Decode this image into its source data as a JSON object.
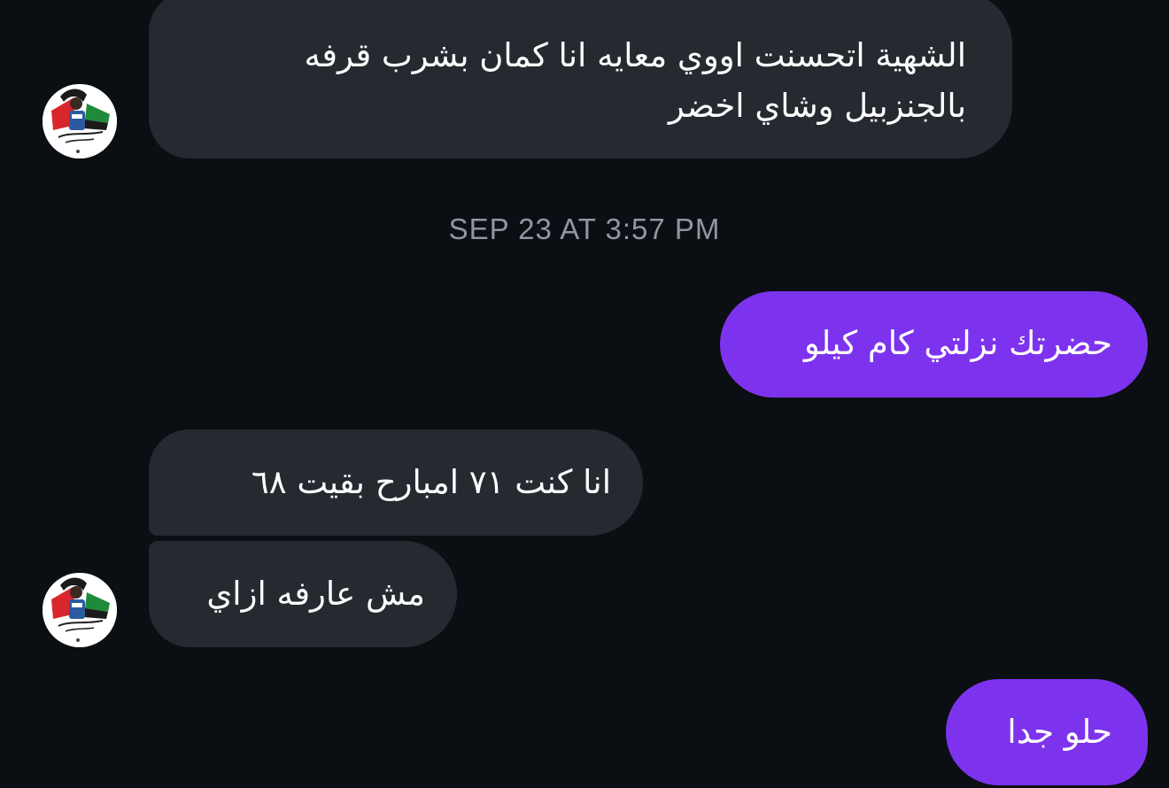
{
  "conversation": {
    "messages": [
      {
        "direction": "incoming",
        "text": "الشهية اتحسنت اووي معايه انا كمان بشرب قرفه بالجنزبيل وشاي اخضر"
      },
      {
        "direction": "outgoing",
        "text": "حضرتك نزلتي كام كيلو"
      },
      {
        "direction": "incoming",
        "text": "انا كنت ٧١ امبارح بقيت ٦٨"
      },
      {
        "direction": "incoming",
        "text": "مش عارفه ازاي"
      },
      {
        "direction": "outgoing",
        "text": "حلو جدا"
      }
    ],
    "timestamp": "SEP 23 AT 3:57 PM"
  },
  "colors": {
    "background": "#0b0e12",
    "incoming_bubble": "#262a30",
    "outgoing_bubble": "#7d33ee",
    "timestamp_text": "#9097a0"
  },
  "icons": {
    "avatar": "contact-avatar-icon"
  }
}
